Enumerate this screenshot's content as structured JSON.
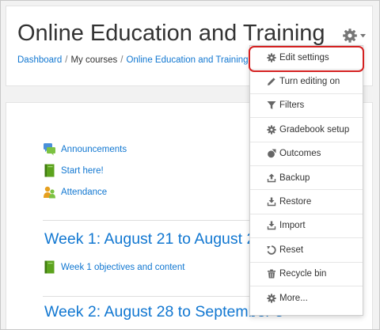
{
  "header": {
    "title": "Online Education and Training",
    "breadcrumb": [
      "Dashboard",
      "My courses",
      "Online Education and Training"
    ]
  },
  "sections": [
    {
      "title": "",
      "activities": [
        {
          "label": "Announcements",
          "icon": "forum-icon"
        },
        {
          "label": "Start here!",
          "icon": "book-icon"
        },
        {
          "label": "Attendance",
          "icon": "attendance-icon"
        }
      ]
    },
    {
      "title": "Week 1: August 21 to August 2",
      "activities": [
        {
          "label": "Week 1 objectives and content",
          "icon": "book-icon"
        }
      ]
    },
    {
      "title": "Week 2: August 28 to September 3",
      "activities": []
    }
  ],
  "menu": {
    "items": [
      {
        "label": "Edit settings",
        "icon": "gear-icon"
      },
      {
        "label": "Turn editing on",
        "icon": "pencil-icon"
      },
      {
        "label": "Filters",
        "icon": "filter-icon"
      },
      {
        "label": "Gradebook setup",
        "icon": "gear-icon"
      },
      {
        "label": "Outcomes",
        "icon": "outcomes-icon"
      },
      {
        "label": "Backup",
        "icon": "upload-icon"
      },
      {
        "label": "Restore",
        "icon": "download-icon"
      },
      {
        "label": "Import",
        "icon": "download-icon"
      },
      {
        "label": "Reset",
        "icon": "reset-icon"
      },
      {
        "label": "Recycle bin",
        "icon": "trash-icon"
      },
      {
        "label": "More...",
        "icon": "gear-icon"
      }
    ]
  },
  "colors": {
    "link": "#1177d1",
    "highlight": "#d42020",
    "book": "#5ca31d"
  }
}
